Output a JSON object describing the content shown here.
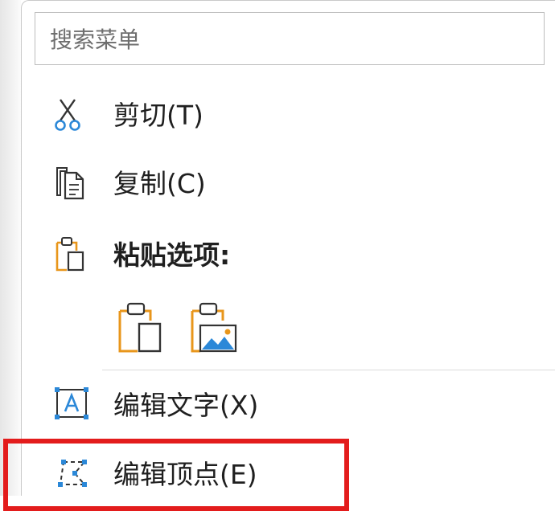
{
  "search": {
    "placeholder": "搜索菜单"
  },
  "menu": {
    "cut": {
      "label": "剪切",
      "shortcut": "(T)",
      "icon": "scissors-icon"
    },
    "copy": {
      "label": "复制",
      "shortcut": "(C)",
      "icon": "copy-icon"
    },
    "paste_options": {
      "label": "粘贴选项:",
      "icon": "clipboard-icon"
    },
    "paste_buttons": [
      {
        "name": "keep-text-only",
        "icon": "paste-text-icon"
      },
      {
        "name": "picture",
        "icon": "paste-picture-icon"
      }
    ],
    "edit_text": {
      "label": "编辑文字",
      "shortcut": "(X)",
      "icon": "text-box-icon"
    },
    "edit_points": {
      "label": "编辑顶点",
      "shortcut": "(E)",
      "icon": "edit-points-icon"
    }
  },
  "colors": {
    "accent_orange": "#E8961B",
    "accent_blue": "#2B88D8",
    "highlight_red": "#E31C1C"
  }
}
